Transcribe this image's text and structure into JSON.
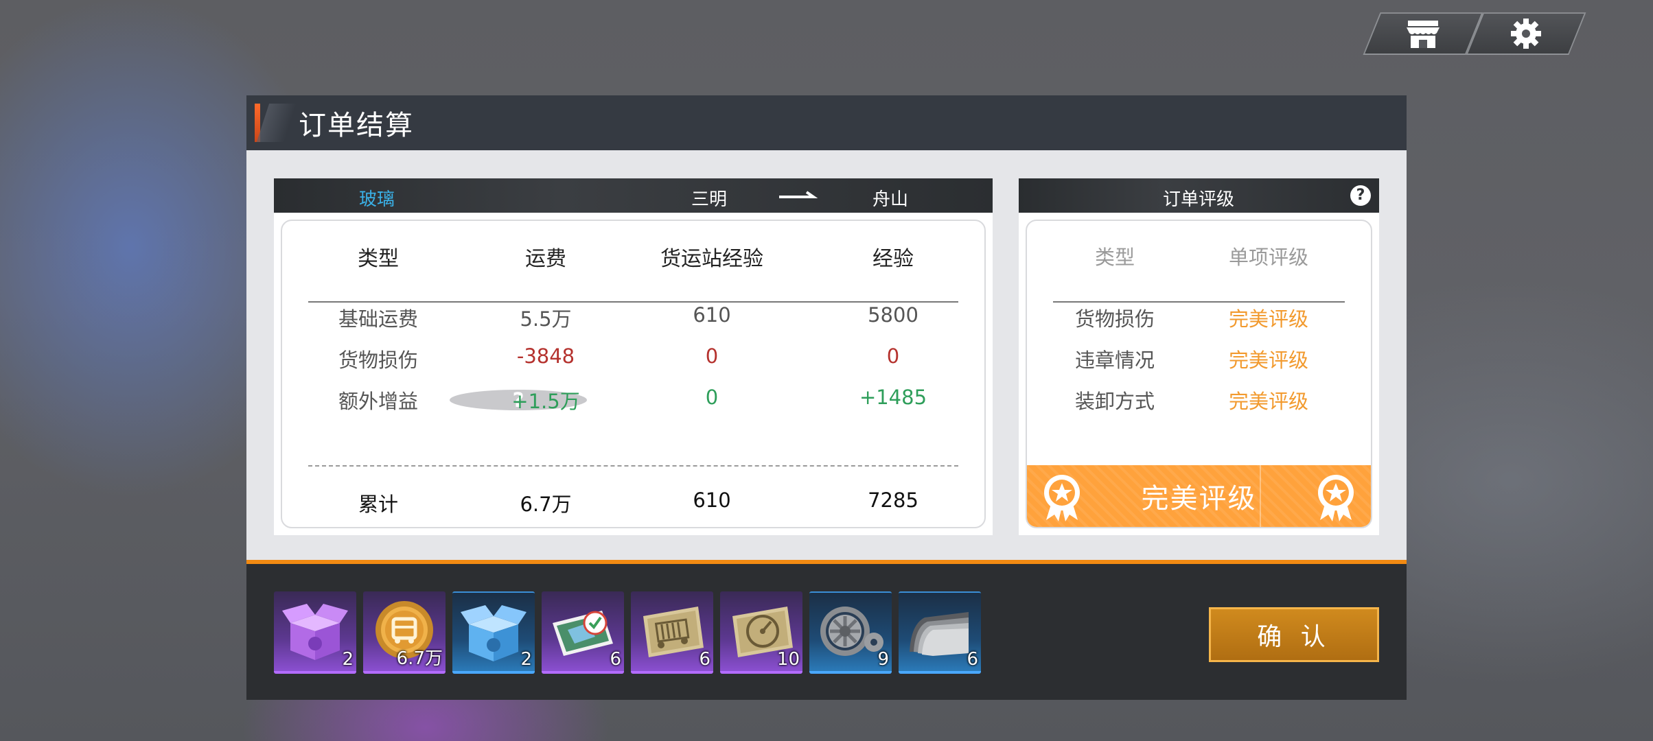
{
  "top_buttons": {
    "shop_icon": "shop-icon",
    "settings_icon": "gear-icon"
  },
  "panel": {
    "title": "订单结算"
  },
  "order": {
    "cargo": "玻璃",
    "from": "三明",
    "to": "舟山"
  },
  "table": {
    "headers": [
      "类型",
      "运费",
      "货运站经验",
      "经验"
    ],
    "rows": [
      {
        "label": "基础运费",
        "fee": "5.5万",
        "station_exp": "610",
        "exp": "5800"
      },
      {
        "label": "货物损伤",
        "fee": "-3848",
        "station_exp": "0",
        "exp": "0"
      },
      {
        "label": "额外增益",
        "fee": "+1.5万",
        "station_exp": "0",
        "exp": "+1485"
      }
    ],
    "total": {
      "label": "累计",
      "fee": "6.7万",
      "station_exp": "610",
      "exp": "7285"
    }
  },
  "rating": {
    "title": "订单评级",
    "headers": [
      "类型",
      "单项评级"
    ],
    "rows": [
      {
        "label": "货物损伤",
        "grade": "完美评级"
      },
      {
        "label": "违章情况",
        "grade": "完美评级"
      },
      {
        "label": "装卸方式",
        "grade": "完美评级"
      }
    ],
    "overall": "完美评级"
  },
  "rewards": [
    {
      "icon": "purple-gift-box-icon",
      "count": "2",
      "rarity": "purple"
    },
    {
      "icon": "gold-bus-coin-icon",
      "count": "6.7万",
      "rarity": "purple"
    },
    {
      "icon": "blue-gift-box-icon",
      "count": "2",
      "rarity": "blue"
    },
    {
      "icon": "map-license-icon",
      "count": "6",
      "rarity": "purple"
    },
    {
      "icon": "truck-card-icon",
      "count": "6",
      "rarity": "purple"
    },
    {
      "icon": "gauge-card-icon",
      "count": "10",
      "rarity": "purple"
    },
    {
      "icon": "gear-part-icon",
      "count": "9",
      "rarity": "blue"
    },
    {
      "icon": "steel-sheet-icon",
      "count": "6",
      "rarity": "blue"
    }
  ],
  "confirm_label": "确 认",
  "colors": {
    "accent_orange": "#f28a12",
    "gold": "#f29a2e",
    "negative": "#b5322e",
    "positive": "#2e9e5a",
    "cargo_blue": "#3ab0e6"
  }
}
